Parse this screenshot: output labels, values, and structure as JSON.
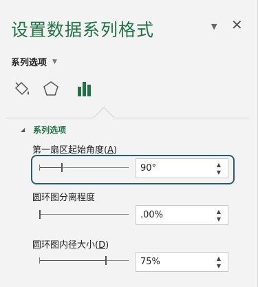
{
  "pane": {
    "title": "设置数据系列格式",
    "options_label": "系列选项"
  },
  "tabs": [
    {
      "name": "fill-line",
      "icon": "paint-bucket-icon"
    },
    {
      "name": "effects",
      "icon": "pentagon-icon"
    },
    {
      "name": "series-options",
      "icon": "bar-chart-icon",
      "active": true
    }
  ],
  "section": {
    "title": "系列选项"
  },
  "fields": [
    {
      "label": "第一扇区起始角度(",
      "mnemonic": "A",
      "label_suffix": ")",
      "value": "90°",
      "slider_fraction": 0.25
    },
    {
      "label": "圆环图分离程度",
      "mnemonic": "",
      "label_suffix": "",
      "value": ".00%",
      "slider_fraction": 0.0
    },
    {
      "label": "圆环图内径大小(",
      "mnemonic": "D",
      "label_suffix": ")",
      "value": "75%",
      "slider_fraction": 0.75
    }
  ],
  "colors": {
    "accent": "#217346",
    "focus": "#2a5b6e"
  }
}
